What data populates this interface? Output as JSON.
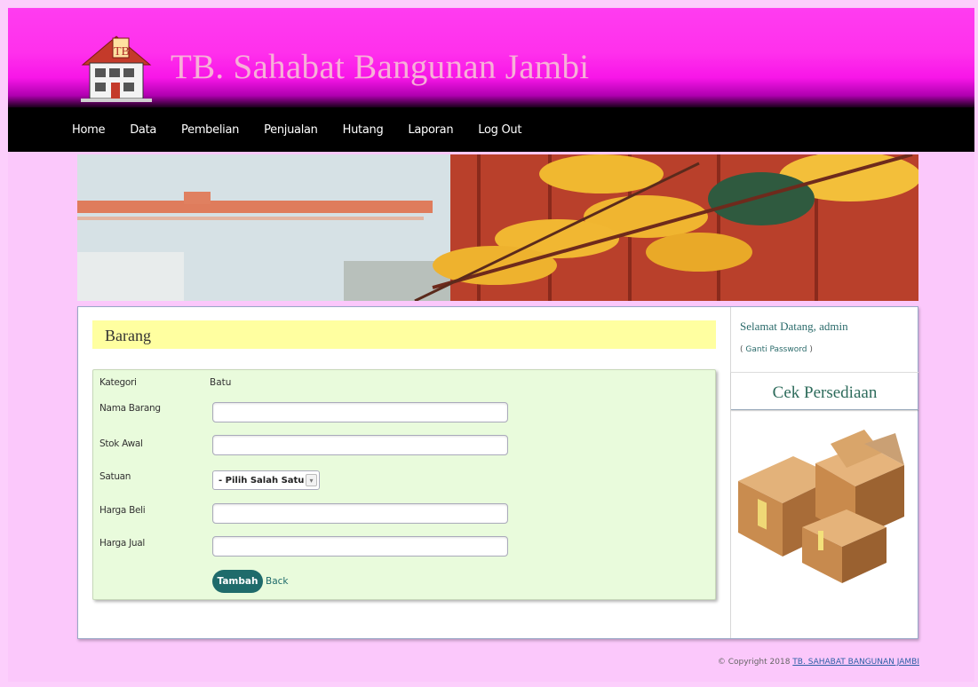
{
  "header": {
    "title": "TB. Sahabat Bangunan Jambi",
    "logo_text": "TB"
  },
  "nav": {
    "items": [
      {
        "label": "Home"
      },
      {
        "label": "Data"
      },
      {
        "label": "Pembelian"
      },
      {
        "label": "Penjualan"
      },
      {
        "label": "Hutang"
      },
      {
        "label": "Laporan"
      },
      {
        "label": "Log Out"
      }
    ]
  },
  "content": {
    "section_title": "Barang",
    "form": {
      "kategori_label": "Kategori",
      "kategori_value": "Batu",
      "nama_barang_label": "Nama Barang",
      "nama_barang_value": "",
      "stok_awal_label": "Stok Awal",
      "stok_awal_value": "",
      "satuan_label": "Satuan",
      "satuan_selected": "- Pilih Salah Satu -",
      "harga_beli_label": "Harga Beli",
      "harga_beli_value": "",
      "harga_jual_label": "Harga Jual",
      "harga_jual_value": "",
      "submit_label": "Tambah",
      "back_label": "Back"
    }
  },
  "sidebar": {
    "welcome": "Selamat Datang, admin",
    "ganti_open": "( ",
    "ganti_link": "Ganti Password",
    "ganti_close": " )",
    "cek_title": "Cek Persediaan"
  },
  "footer": {
    "copyright": "© Copyright 2018 ",
    "link": "TB. SAHABAT BANGUNAN JAMBI"
  },
  "colors": {
    "page_bg": "#fccffc",
    "header_pink": "#ff30ec",
    "nav_bg": "#000000",
    "section_title_bg": "#ffffa0",
    "form_bg": "#e9fbdc",
    "button_teal": "#1f6b6b"
  }
}
